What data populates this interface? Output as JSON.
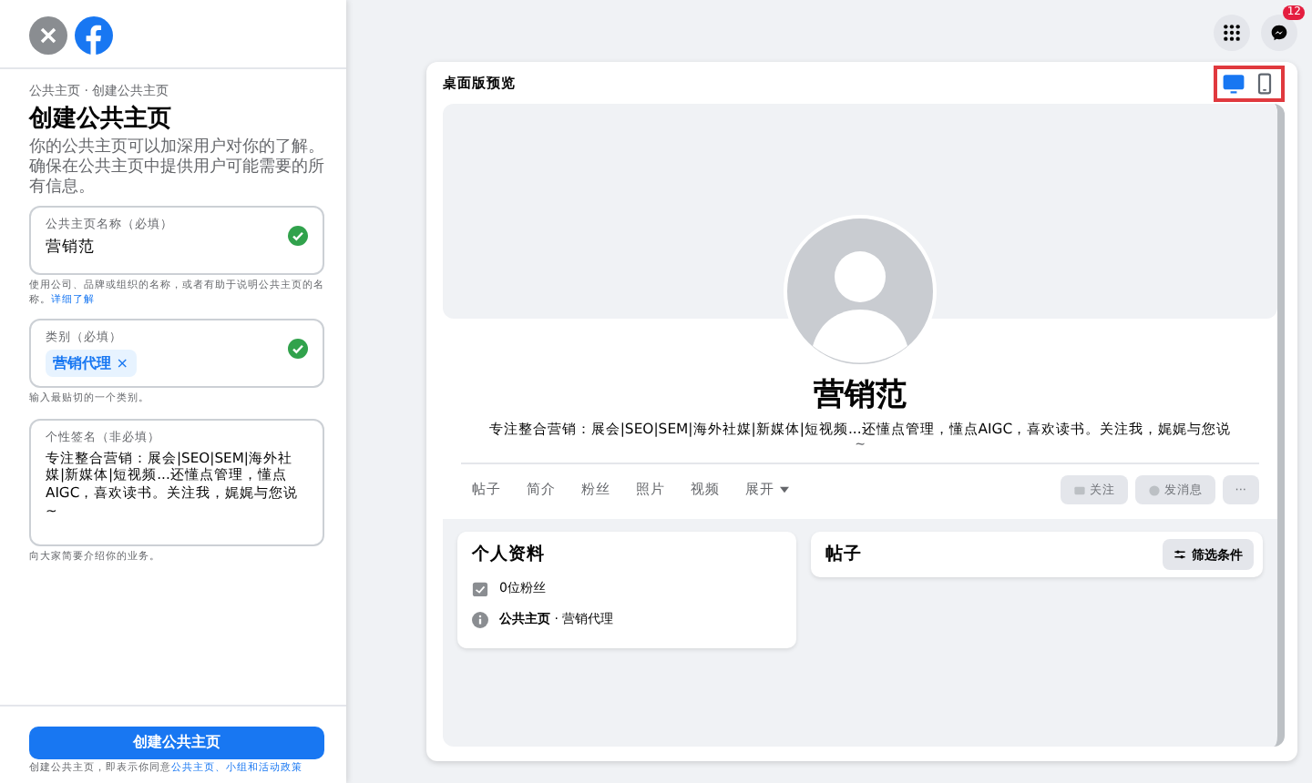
{
  "sidebar": {
    "breadcrumb": "公共主页 · 创建公共主页",
    "title": "创建公共主页",
    "intro": "你的公共主页可以加深用户对你的了解。确保在公共主页中提供用户可能需要的所有信息。",
    "fields": [
      {
        "kind": "text",
        "label": "公共主页名称（必填）",
        "value": "营销范",
        "valid": true,
        "help": "使用公司、品牌或组织的名称，或者有助于说明公共主页的名称。",
        "help_link": "详细了解"
      },
      {
        "kind": "tags",
        "label": "类别（必填）",
        "tags": [
          "营销代理"
        ],
        "tag_remove": "×",
        "valid": true,
        "help": "输入最贴切的一个类别。"
      },
      {
        "kind": "textarea",
        "label": "个性签名（非必填）",
        "value": "专注整合营销：展会|SEO|SEM|海外社媒|新媒体|短视频...还懂点管理，懂点AIGC，喜欢读书。关注我，娓娓与您说~",
        "valid": false,
        "help": "向大家简要介绍你的业务。"
      }
    ],
    "submit": "创建公共主页",
    "terms": "创建公共主页，即表示你同意",
    "terms_link": "公共主页、小组和活动政策"
  },
  "topbar": {
    "notification_count": "12"
  },
  "preview": {
    "title": "桌面版预览",
    "devices": [
      {
        "kind": "desktop",
        "selected": true
      },
      {
        "kind": "mobile",
        "selected": false
      }
    ],
    "page_name": "营销范",
    "bio": "专注整合营销：展会|SEO|SEM|海外社媒|新媒体|短视频...还懂点管理，懂点AIGC，喜欢读书。关注我，娓娓与您说",
    "bio_tail": "~",
    "tabs": [
      {
        "label": "帖子",
        "dropdown": false
      },
      {
        "label": "简介",
        "dropdown": false
      },
      {
        "label": "粉丝",
        "dropdown": false
      },
      {
        "label": "照片",
        "dropdown": false
      },
      {
        "label": "视频",
        "dropdown": false
      },
      {
        "label": "展开",
        "dropdown": true
      }
    ],
    "actions": [
      {
        "kind": "follow",
        "label": "关注"
      },
      {
        "kind": "message",
        "label": "发消息"
      },
      {
        "kind": "more",
        "label": "···"
      }
    ],
    "about": {
      "title": "个人资料",
      "items": [
        {
          "kind": "followers",
          "text": "0位粉丝"
        },
        {
          "kind": "info",
          "bold": "公共主页",
          "text": " · 营销代理"
        }
      ]
    },
    "posts": {
      "title": "帖子",
      "filter": "筛选条件"
    }
  }
}
